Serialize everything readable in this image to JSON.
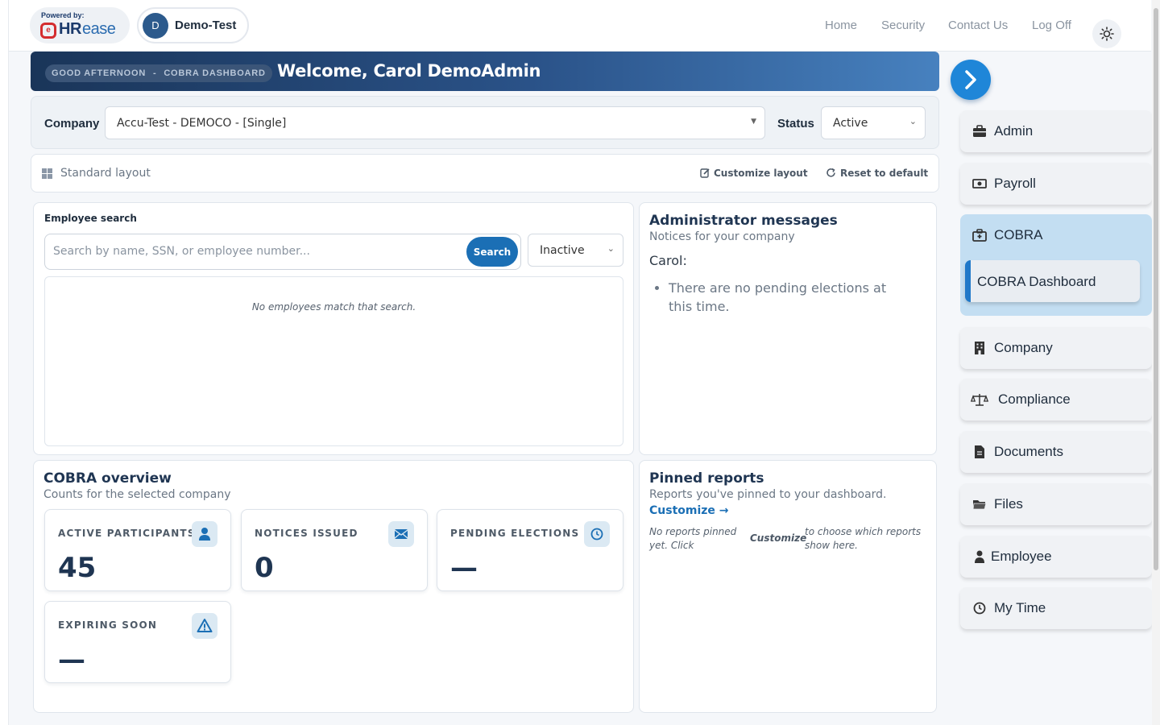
{
  "header": {
    "logo": {
      "powered_by": "Powered by:",
      "brand_hr": "HR",
      "brand_ease": "ease"
    },
    "company": {
      "initial": "D",
      "name": "Demo-Test"
    },
    "nav": [
      "Home",
      "Security",
      "Contact Us",
      "Log Off"
    ],
    "theme_icon": "sun-icon"
  },
  "banner": {
    "kicker_greeting": "GOOD AFTERNOON",
    "kicker_sep": "-",
    "kicker_page": "COBRA DASHBOARD",
    "title": "Welcome, Carol DemoAdmin"
  },
  "filters": {
    "company_label": "Company",
    "company_value": "Accu-Test - DEMOCO - [Single]",
    "status_label": "Status",
    "status_value": "Active"
  },
  "layout_bar": {
    "label": "Standard layout",
    "customize": "Customize layout",
    "reset": "Reset to default"
  },
  "employee_search": {
    "heading": "Employee search",
    "placeholder": "Search by name, SSN, or employee number...",
    "button": "Search",
    "status_filter": "Inactive",
    "empty_message": "No employees match that search."
  },
  "admin_messages": {
    "title": "Administrator messages",
    "subtitle": "Notices for your company",
    "greeting": "Carol:",
    "items": [
      "There are no pending elections at this time."
    ]
  },
  "cobra_overview": {
    "title": "COBRA overview",
    "subtitle": "Counts for the selected company",
    "stats": [
      {
        "label": "ACTIVE PARTICIPANTS",
        "value": "45",
        "icon": "user-icon"
      },
      {
        "label": "NOTICES ISSUED",
        "value": "0",
        "icon": "envelope-icon"
      },
      {
        "label": "PENDING ELECTIONS",
        "value": "—",
        "icon": "clock-icon"
      },
      {
        "label": "EXPIRING SOON",
        "value": "—",
        "icon": "warning-icon"
      }
    ]
  },
  "pinned_reports": {
    "title": "Pinned reports",
    "subtitle": "Reports you've pinned to your dashboard.",
    "link": "Customize →",
    "empty_pre": "No reports pinned yet. Click",
    "empty_link": "Customize",
    "empty_post": "to choose which reports show here."
  },
  "sidebar": {
    "toggle_icon": "chevron-right-icon",
    "items": [
      {
        "label": "Admin",
        "icon": "briefcase-icon"
      },
      {
        "label": "Payroll",
        "icon": "money-icon"
      },
      {
        "label": "COBRA",
        "icon": "medkit-icon",
        "active": true,
        "children": [
          {
            "label": "COBRA Dashboard",
            "active": true
          }
        ]
      },
      {
        "label": "Company",
        "icon": "building-icon"
      },
      {
        "label": "Compliance",
        "icon": "scale-icon"
      },
      {
        "label": "Documents",
        "icon": "document-icon"
      },
      {
        "label": "Files",
        "icon": "folder-icon"
      },
      {
        "label": "Employee",
        "icon": "person-icon"
      },
      {
        "label": "My Time",
        "icon": "clock-icon"
      }
    ]
  },
  "colors": {
    "brand_blue": "#1b6fb5",
    "accent": "#1f86d8",
    "active_group": "#c3def2",
    "banner_dark": "#1a3559"
  }
}
